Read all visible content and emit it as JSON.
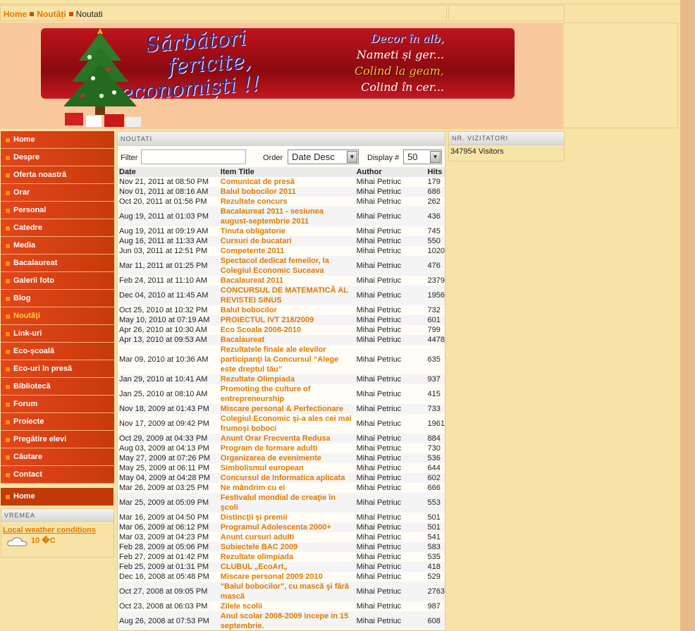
{
  "breadcrumb": {
    "home": "Home",
    "section": "Noutăți",
    "current": "Noutati"
  },
  "banner": {
    "line1": "Sărbători",
    "line2": "fericite,",
    "line3": "economiști !!",
    "verse": [
      "Decor în alb,",
      "Nameti și ger...",
      "Colind la geam,",
      "Colind în cer..."
    ]
  },
  "nav": [
    "Home",
    "Despre",
    "Oferta noastră",
    "Orar",
    "Personal",
    "Catedre",
    "Media",
    "Bacalaureat",
    "Galerii foto",
    "Blog",
    "Noutăți",
    "Link-uri",
    "Eco-școală",
    "Eco-uri în presă",
    "Bibliotecă",
    "Forum",
    "Proiecte",
    "Pregătire elevi",
    "Căutare",
    "Contact"
  ],
  "nav_home2": "Home",
  "weather": {
    "title": "VREMEA",
    "link": "Local weather conditions",
    "temp": "10 �C"
  },
  "news": {
    "title": "NOUTATI",
    "filter_label": "Filter",
    "filter_value": "",
    "order_label": "Order",
    "order_value": "Date Desc",
    "display_label": "Display #",
    "display_value": "50",
    "headers": [
      "Date",
      "Item Title",
      "Author",
      "Hits"
    ]
  },
  "rows": [
    [
      "Nov 21, 2011 at 08:50 PM",
      "Comunicat de presă",
      "Mihai Petriuc",
      "179"
    ],
    [
      "Nov 01, 2011 at 08:16 AM",
      "Balul bobocilor 2011",
      "Mihai Petriuc",
      "686"
    ],
    [
      "Oct 20, 2011 at 01:56 PM",
      "Rezultate concurs",
      "Mihai Petriuc",
      "262"
    ],
    [
      "Aug 19, 2011 at 01:03 PM",
      "Bacalaureat 2011 - sesiunea august-septembrie 2011",
      "Mihai Petriuc",
      "436"
    ],
    [
      "Aug 19, 2011 at 09:19 AM",
      "Tinuta obligatorie",
      "Mihai Petriuc",
      "745"
    ],
    [
      "Aug 16, 2011 at 11:33 AM",
      "Cursuri de bucatari",
      "Mihai Petriuc",
      "550"
    ],
    [
      "Jun 03, 2011 at 12:51 PM",
      "Competente 2011",
      "Mihai Petriuc",
      "1020"
    ],
    [
      "Mar 11, 2011 at 01:25 PM",
      "Spectacol dedicat femeilor, la Colegiul Economic Suceava",
      "Mihai Petriuc",
      "476"
    ],
    [
      "Feb 24, 2011 at 11:10 AM",
      "Bacalaureat 2011",
      "Mihai Petriuc",
      "2379"
    ],
    [
      "Dec 04, 2010 at 11:45 AM",
      "CONCURSUL DE MATEMATICĂ AL REVISTEI SINUS",
      "Mihai Petriuc",
      "1956"
    ],
    [
      "Oct 25, 2010 at 10:32 PM",
      "Balul bobocilor",
      "Mihai Petriuc",
      "732"
    ],
    [
      "May 10, 2010 at 07:19 AM",
      "PROIECTUL IVT 218/2009",
      "Mihai Petriuc",
      "601"
    ],
    [
      "Apr 26, 2010 at 10:30 AM",
      "Eco Scoala 2008-2010",
      "Mihai Petriuc",
      "799"
    ],
    [
      "Apr 13, 2010 at 09:53 AM",
      "Bacalaureat",
      "Mihai Petriuc",
      "4478"
    ],
    [
      "Mar 09, 2010 at 10:36 AM",
      "Rezultatele finale ale elevilor participanţi la Concursul “Alege este dreptul tău”",
      "Mihai Petriuc",
      "635"
    ],
    [
      "Jan 29, 2010 at 10:41 AM",
      "Rezultate Olimpiada",
      "Mihai Petriuc",
      "937"
    ],
    [
      "Jan 25, 2010 at 08:10 AM",
      "Promoting the culture of entrepreneurship",
      "Mihai Petriuc",
      "415"
    ],
    [
      "Nov 18, 2009 at 01:43 PM",
      "Miscare personal & Perfectionare",
      "Mihai Petriuc",
      "733"
    ],
    [
      "Nov 17, 2009 at 09:42 PM",
      "Colegiul Economic şi-a ales cei mai frumoşi boboci",
      "Mihai Petriuc",
      "1961"
    ],
    [
      "Oct 29, 2009 at 04:33 PM",
      "Anunt Orar Frecventa Redusa",
      "Mihai Petriuc",
      "884"
    ],
    [
      "Aug 03, 2009 at 04:13 PM",
      "Program de formare adulti",
      "Mihai Petriuc",
      "730"
    ],
    [
      "May 27, 2009 at 07:26 PM",
      "Organizarea de evenimente",
      "Mihai Petriuc",
      "536"
    ],
    [
      "May 25, 2009 at 06:11 PM",
      "Simbolismul european",
      "Mihai Petriuc",
      "644"
    ],
    [
      "May 04, 2009 at 04:28 PM",
      "Concursul de Informatica aplicata",
      "Mihai Petriuc",
      "602"
    ],
    [
      "Mar 26, 2009 at 03:25 PM",
      "Ne mândrim cu ei",
      "Mihai Petriuc",
      "666"
    ],
    [
      "Mar 25, 2009 at 05:09 PM",
      "Festivalul mondial de creaţie în şcoli",
      "Mihai Petriuc",
      "553"
    ],
    [
      "Mar 16, 2009 at 04:50 PM",
      "Distincţii şi premii",
      "Mihai Petriuc",
      "501"
    ],
    [
      "Mar 06, 2009 at 06:12 PM",
      "Programul Adolescenta 2000+",
      "Mihai Petriuc",
      "501"
    ],
    [
      "Mar 03, 2009 at 04:23 PM",
      "Anunt cursuri adulti",
      "Mihai Petriuc",
      "541"
    ],
    [
      "Feb 28, 2009 at 05:06 PM",
      "Subiectele BAC 2009",
      "Mihai Petriuc",
      "583"
    ],
    [
      "Feb 27, 2009 at 01:42 PM",
      "Rezultate olimpiada",
      "Mihai Petriuc",
      "535"
    ],
    [
      "Feb 25, 2009 at 01:31 PM",
      "CLUBUL „EcoArt„",
      "Mihai Petriuc",
      "418"
    ],
    [
      "Dec 16, 2008 at 05:48 PM",
      "Miscare personal 2009 2010",
      "Mihai Petriuc",
      "529"
    ],
    [
      "Oct 27, 2008 at 09:05 PM",
      "\"Balul bobocilor\", cu mască şi fără mască",
      "Mihai Petriuc",
      "2763"
    ],
    [
      "Oct 23, 2008 at 06:03 PM",
      "Zilele scolii",
      "Mihai Petriuc",
      "987"
    ],
    [
      "Aug 26, 2008 at 07:53 PM",
      "Anul scolar 2008-2009 incepe in 15 septembrie.",
      "Mihai Petriuc",
      "608"
    ]
  ],
  "visitors": {
    "title": "NR. VIZITATORI",
    "count": "347954 Visitors"
  }
}
